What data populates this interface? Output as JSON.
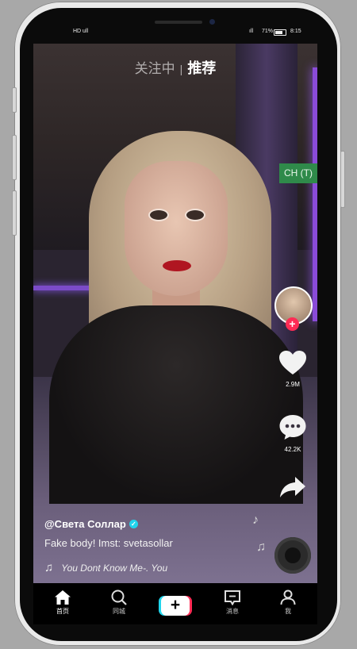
{
  "status_bar": {
    "left": "HD ull",
    "right_signal": "ıll",
    "battery_pct": "71%",
    "time": "8:15"
  },
  "top_tabs": {
    "following": "关注中",
    "separator": "|",
    "recommend": "推荐"
  },
  "translate_chip": {
    "label": "CH (T)"
  },
  "side_rail": {
    "follow_plus": "+",
    "likes_count": "2.9M",
    "comments_count": "42.2K"
  },
  "caption": {
    "username": "@Света Соллар",
    "description": "Fake body! Imst: svetasollar",
    "sound_title": "You Dont Know Me-.  You"
  },
  "bottom_nav": {
    "home": "首页",
    "discover": "同城",
    "create": "+",
    "inbox": "消息",
    "profile": "我"
  },
  "colors": {
    "accent_red": "#fe2c55",
    "accent_cyan": "#20d5ec",
    "translate_green": "#2f8a4a"
  }
}
